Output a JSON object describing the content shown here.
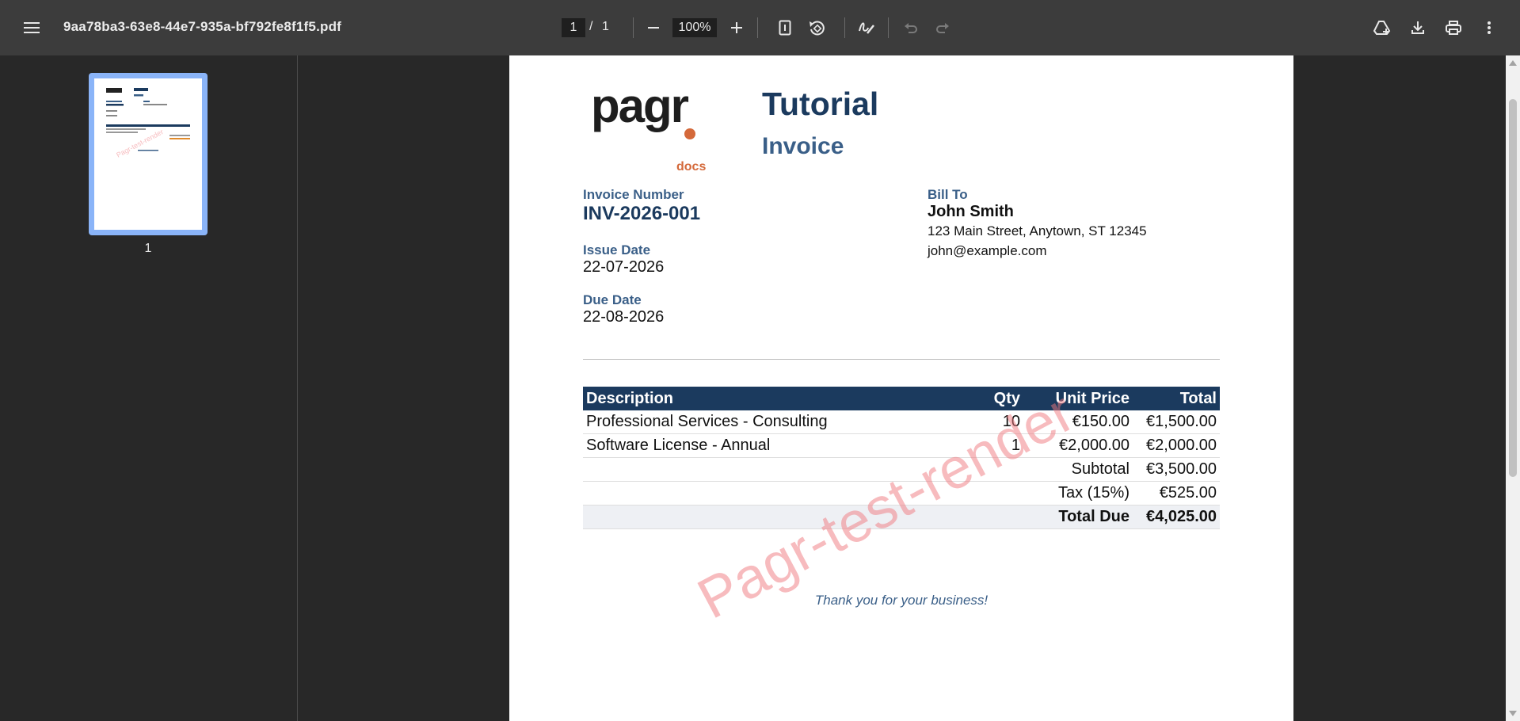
{
  "toolbar": {
    "file_name": "9aa78ba3-63e8-44e7-935a-bf792fe8f1f5.pdf",
    "current_page": "1",
    "page_separator": "/",
    "total_pages": "1",
    "zoom": "100%",
    "icons": [
      "menu-icon",
      "zoom-out-icon",
      "zoom-in-icon",
      "fit-page-icon",
      "rotate-icon",
      "annotate-icon",
      "undo-icon",
      "redo-icon",
      "save-to-drive-icon",
      "download-icon",
      "print-icon",
      "more-icon"
    ]
  },
  "sidebar": {
    "thumbnails": [
      {
        "label": "1"
      }
    ]
  },
  "invoice": {
    "logo_text": "pagr",
    "logo_sub": "docs",
    "title": "Tutorial",
    "subtitle": "Invoice",
    "invoice_number_label": "Invoice Number",
    "invoice_number": "INV-2026-001",
    "issue_date_label": "Issue Date",
    "issue_date": "22-07-2026",
    "due_date_label": "Due Date",
    "due_date": "22-08-2026",
    "bill_to_label": "Bill To",
    "bill_to_name": "John Smith",
    "bill_to_address": "123 Main Street, Anytown, ST 12345",
    "bill_to_email": "john@example.com",
    "table": {
      "headers": [
        "Description",
        "Qty",
        "Unit Price",
        "Total"
      ],
      "rows": [
        {
          "description": "Professional Services - Consulting",
          "qty": "10",
          "unit_price": "€150.00",
          "total": "€1,500.00"
        },
        {
          "description": "Software License - Annual",
          "qty": "1",
          "unit_price": "€2,000.00",
          "total": "€2,000.00"
        }
      ],
      "subtotal_label": "Subtotal",
      "subtotal": "€3,500.00",
      "tax_label": "Tax (15%)",
      "tax": "€525.00",
      "total_due_label": "Total Due",
      "total_due": "€4,025.00"
    },
    "thanks": "Thank you for your business!",
    "watermark": "Pagr-test-render"
  },
  "colors": {
    "toolbar_bg": "#3c3c3c",
    "viewer_bg": "#282828",
    "accent_navy": "#1b3a5e",
    "accent_blue": "#3a5f88",
    "accent_orange": "#e08a2a",
    "logo_orange": "#d4693a",
    "thumb_highlight": "#8ab4f8"
  }
}
